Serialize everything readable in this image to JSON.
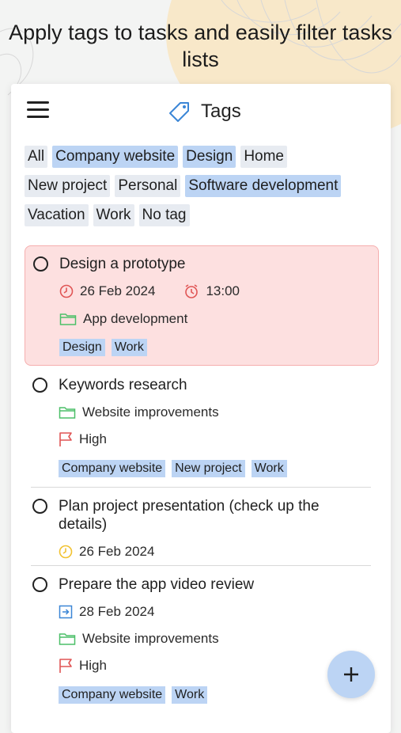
{
  "headline": "Apply tags to tasks and easily filter tasks lists",
  "header": {
    "title": "Tags",
    "title_icon": "tag-icon",
    "menu_icon": "hamburger-menu-icon"
  },
  "filter_chips": [
    [
      "All",
      "Company website",
      "Design",
      "Home"
    ],
    [
      "New project",
      "Personal",
      "Software development"
    ],
    [
      "Vacation",
      "Work",
      "No tag"
    ]
  ],
  "selected_chips": [
    "Company website",
    "Design",
    "Software development"
  ],
  "tasks": [
    {
      "title": "Design a prototype",
      "date": "26 Feb 2024",
      "time": "13:00",
      "folder": "App development",
      "tags": [
        "Design",
        "Work"
      ],
      "highlighted": true
    },
    {
      "title": "Keywords research",
      "folder": "Website improvements",
      "priority": "High",
      "tags": [
        "Company website",
        "New project",
        "Work"
      ]
    },
    {
      "title": "Plan project presentation (check up the details)",
      "date": "26 Feb 2024"
    },
    {
      "title": "Prepare the app video review",
      "date": "28 Feb 2024",
      "folder": "Website improvements",
      "priority": "High",
      "tags": [
        "Company website",
        "Work"
      ]
    }
  ],
  "fab_icon": "plus-icon",
  "colors": {
    "accent_chip": "#bcd4f4",
    "highlight_bg": "#fde0e0",
    "overdue": "#e05555",
    "folder": "#4cbf68",
    "today": "#f2c230",
    "scheduled": "#3b86d6"
  }
}
